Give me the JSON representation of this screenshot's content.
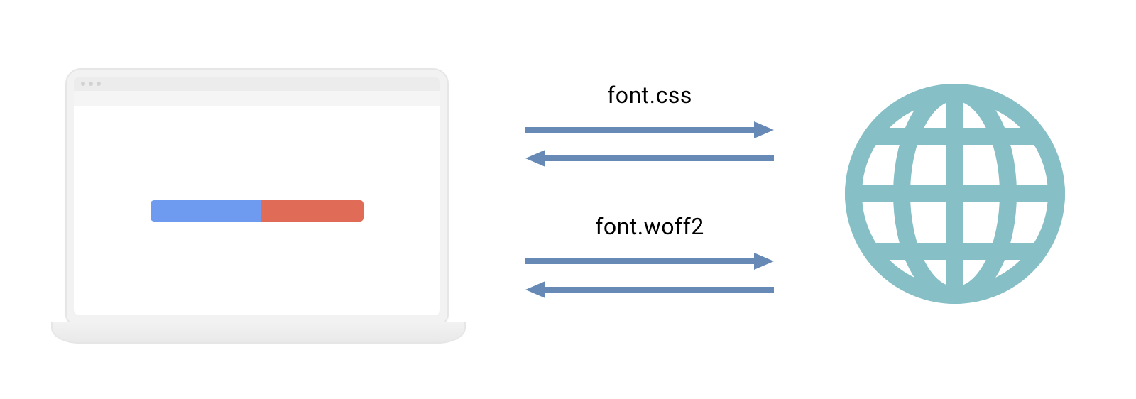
{
  "labels": {
    "first": "font.css",
    "second": "font.woff2"
  },
  "laptop": {
    "progress_blue_pct": 52,
    "progress_red_pct": 48
  },
  "colors": {
    "arrow": "#6789b5",
    "globe": "#86bfc6",
    "progress_blue": "#6e9af0",
    "progress_red": "#e06b56"
  }
}
